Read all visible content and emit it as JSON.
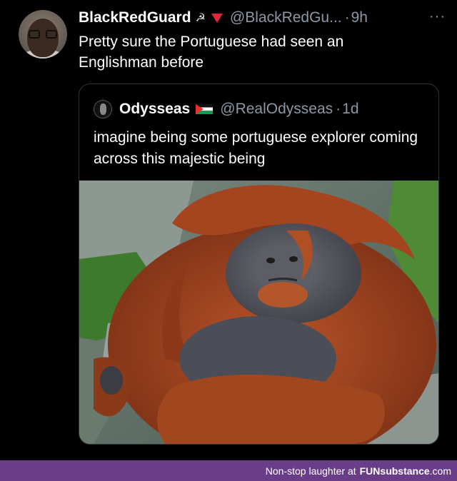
{
  "tweet": {
    "display_name": "BlackRedGuard",
    "emoji_1": "☭",
    "handle": "@BlackRedGu...",
    "separator": "·",
    "time": "9h",
    "more": "···",
    "text": "Pretty sure the Portuguese had seen an Englishman before"
  },
  "quoted": {
    "display_name": "Odysseas",
    "handle": "@RealOdysseas",
    "separator": "·",
    "time": "1d",
    "text": "imagine being some portuguese explorer coming across this majestic being"
  },
  "footer": {
    "prefix": "Non-stop laughter at",
    "brand_fun": "FUN",
    "brand_sub": "substance",
    "brand_dom": ".com"
  },
  "icons": {
    "avatar": "user-avatar",
    "quoted_avatar": "quoted-user-avatar",
    "emoji_2": "red-triangle-down-icon",
    "flag": "palestine-flag-icon",
    "photo": "orangutan-photo"
  },
  "colors": {
    "background": "#000000",
    "text": "#ffffff",
    "secondary": "#8b98a5",
    "border": "#2f3336",
    "footer_bg": "#6a3d88"
  }
}
